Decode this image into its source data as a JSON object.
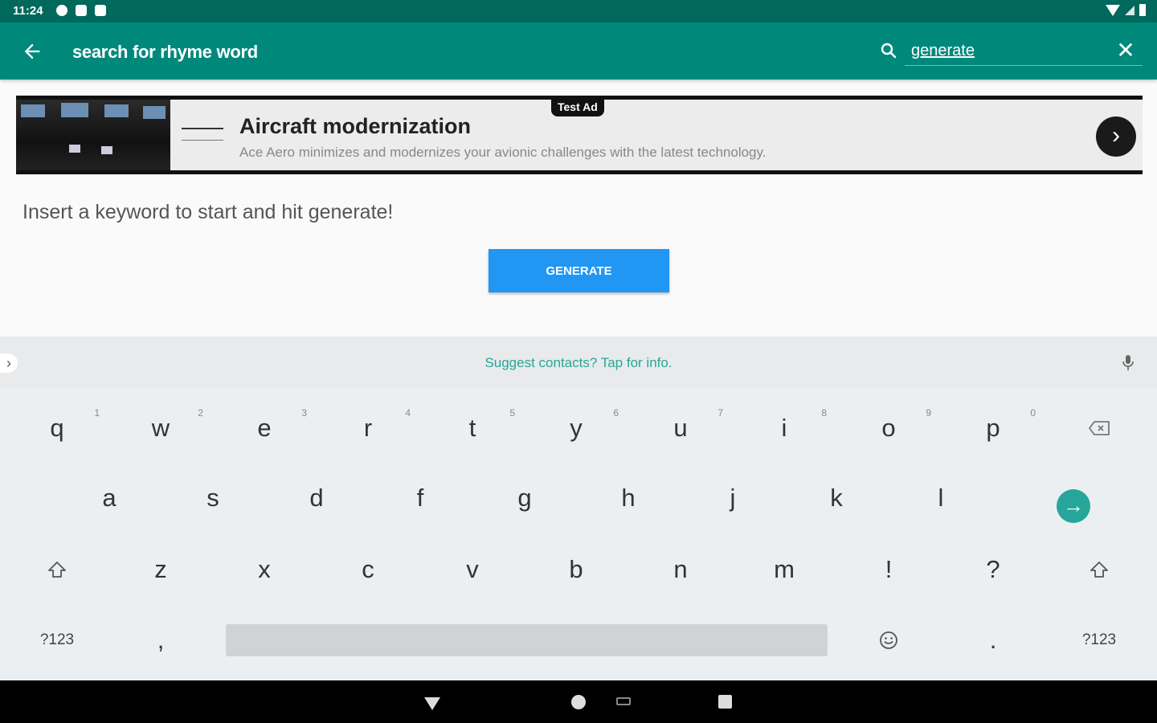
{
  "status_bar": {
    "time": "11:24"
  },
  "toolbar": {
    "title": "search for rhyme word",
    "search_value": "generate"
  },
  "ad": {
    "badge": "Test Ad",
    "title": "Aircraft modernization",
    "description": "Ace Aero minimizes and modernizes your avionic challenges with the latest technology."
  },
  "main": {
    "hint": "Insert a keyword to start and hit generate!",
    "generate_label": "GENERATE"
  },
  "keyboard": {
    "suggestion": "Suggest contacts? Tap for info.",
    "row1": [
      {
        "char": "q",
        "num": "1"
      },
      {
        "char": "w",
        "num": "2"
      },
      {
        "char": "e",
        "num": "3"
      },
      {
        "char": "r",
        "num": "4"
      },
      {
        "char": "t",
        "num": "5"
      },
      {
        "char": "y",
        "num": "6"
      },
      {
        "char": "u",
        "num": "7"
      },
      {
        "char": "i",
        "num": "8"
      },
      {
        "char": "o",
        "num": "9"
      },
      {
        "char": "p",
        "num": "0"
      }
    ],
    "row2": [
      "a",
      "s",
      "d",
      "f",
      "g",
      "h",
      "j",
      "k",
      "l"
    ],
    "row3": [
      "z",
      "x",
      "c",
      "v",
      "b",
      "n",
      "m",
      "!",
      "?"
    ],
    "symbols_label": "?123",
    "comma": ",",
    "period": "."
  },
  "colors": {
    "status_bar": "#00695c",
    "toolbar": "#00897b",
    "accent": "#26a69a",
    "button": "#2196f3"
  }
}
